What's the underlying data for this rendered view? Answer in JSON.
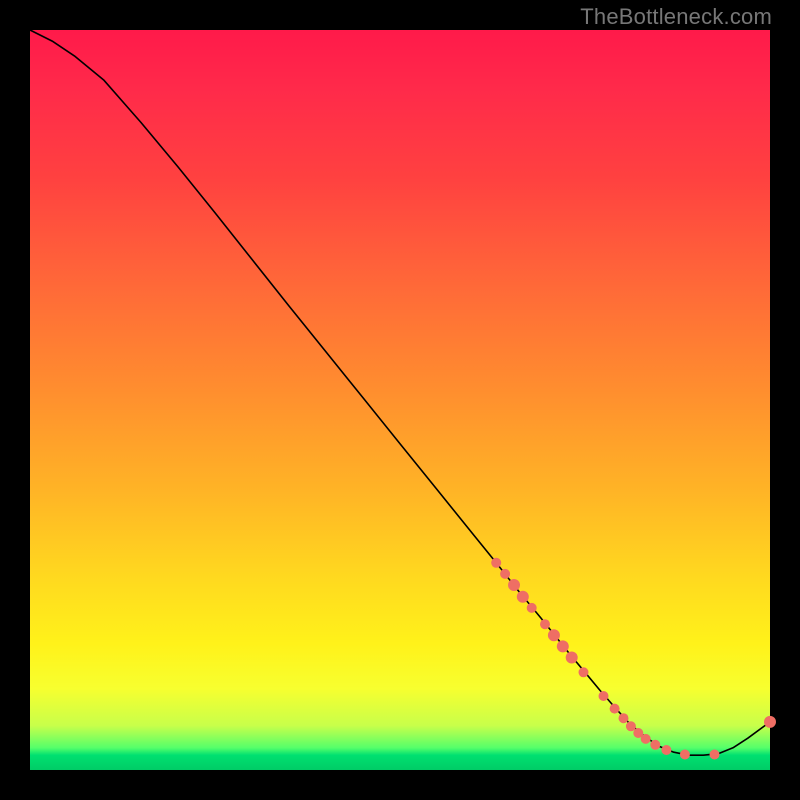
{
  "watermark": "TheBottleneck.com",
  "colors": {
    "marker": "#ef6e64",
    "line": "#000000"
  },
  "chart_data": {
    "type": "line",
    "title": "",
    "xlabel": "",
    "ylabel": "",
    "xlim": [
      0,
      100
    ],
    "ylim": [
      0,
      100
    ],
    "grid": false,
    "legend": false,
    "series": [
      {
        "name": "curve",
        "x": [
          0,
          3,
          6,
          10,
          15,
          20,
          25,
          30,
          35,
          40,
          45,
          50,
          55,
          60,
          63,
          66,
          69,
          71,
          73,
          75,
          77,
          79,
          81,
          83,
          85,
          87,
          89,
          91,
          93,
          95,
          97,
          100
        ],
        "y": [
          100,
          98.5,
          96.5,
          93.2,
          87.5,
          81.5,
          75.3,
          69.0,
          62.7,
          56.5,
          50.3,
          44.1,
          37.9,
          31.7,
          28.0,
          24.2,
          20.6,
          18.1,
          15.6,
          13.2,
          10.8,
          8.5,
          6.3,
          4.6,
          3.2,
          2.4,
          2.0,
          2.0,
          2.2,
          3.0,
          4.3,
          6.5
        ]
      }
    ],
    "markers": [
      {
        "x": 63.0,
        "y": 28.0,
        "r": 5
      },
      {
        "x": 64.2,
        "y": 26.5,
        "r": 5
      },
      {
        "x": 65.4,
        "y": 25.0,
        "r": 6
      },
      {
        "x": 66.6,
        "y": 23.4,
        "r": 6
      },
      {
        "x": 67.8,
        "y": 21.9,
        "r": 5
      },
      {
        "x": 69.6,
        "y": 19.7,
        "r": 5
      },
      {
        "x": 70.8,
        "y": 18.2,
        "r": 6
      },
      {
        "x": 72.0,
        "y": 16.7,
        "r": 6
      },
      {
        "x": 73.2,
        "y": 15.2,
        "r": 6
      },
      {
        "x": 74.8,
        "y": 13.2,
        "r": 5
      },
      {
        "x": 77.5,
        "y": 10.0,
        "r": 5
      },
      {
        "x": 79.0,
        "y": 8.3,
        "r": 5
      },
      {
        "x": 80.2,
        "y": 7.0,
        "r": 5
      },
      {
        "x": 81.2,
        "y": 5.9,
        "r": 5
      },
      {
        "x": 82.2,
        "y": 5.0,
        "r": 5
      },
      {
        "x": 83.2,
        "y": 4.2,
        "r": 5
      },
      {
        "x": 84.5,
        "y": 3.4,
        "r": 5
      },
      {
        "x": 86.0,
        "y": 2.7,
        "r": 5
      },
      {
        "x": 88.5,
        "y": 2.1,
        "r": 5
      },
      {
        "x": 92.5,
        "y": 2.1,
        "r": 5
      },
      {
        "x": 100.0,
        "y": 6.5,
        "r": 6
      }
    ]
  }
}
